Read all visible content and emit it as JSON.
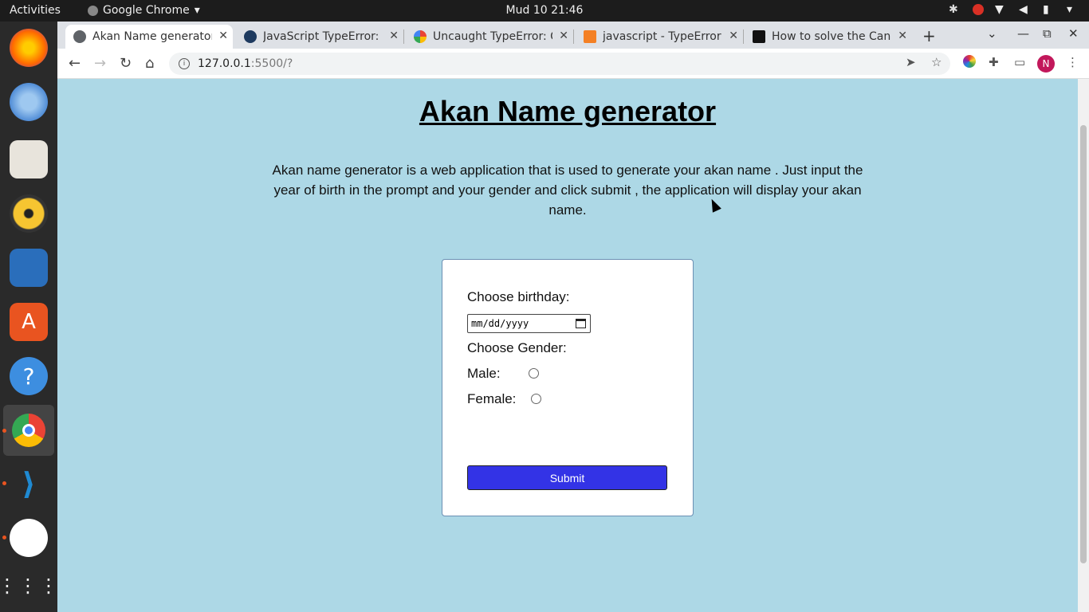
{
  "system_bar": {
    "activities": "Activities",
    "app_name": "Google Chrome",
    "clock": "Mud 10  21:46"
  },
  "browser": {
    "tabs": [
      {
        "title": "Akan Name generator",
        "favicon_color": "#5f6368",
        "active": true
      },
      {
        "title": "JavaScript TypeError: (",
        "favicon_color": "#1e3a5f",
        "active": false
      },
      {
        "title": "Uncaught TypeError: C",
        "favicon_color": "#4285f4",
        "active": false
      },
      {
        "title": "javascript - TypeError:",
        "favicon_color": "#f48024",
        "active": false
      },
      {
        "title": "How to solve the Cann",
        "favicon_color": "#111111",
        "active": false
      }
    ],
    "new_tab": "+",
    "url_host": "127.0.0.1",
    "url_path": ":5500/?",
    "profile_initial": "N"
  },
  "page": {
    "title": "Akan Name generator",
    "intro": "Akan name generator is a web application that is used to generate your akan name . Just input the year of birth in the prompt and your gender and click submit , the application will display your akan name.",
    "form": {
      "birthday_label": "Choose birthday:",
      "date_placeholder": "mm/dd/yyyy",
      "gender_label": "Choose Gender:",
      "male_label": "Male:",
      "female_label": "Female:",
      "submit_label": "Submit"
    }
  },
  "colors": {
    "page_bg": "#add8e6",
    "submit_bg": "#3333e6"
  }
}
